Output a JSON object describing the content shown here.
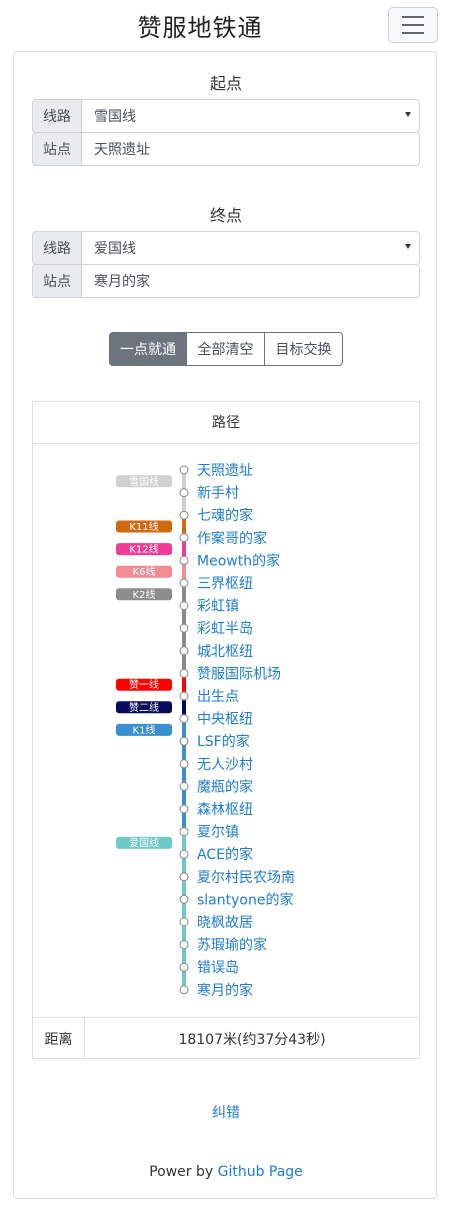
{
  "app": {
    "title": "赞服地铁通"
  },
  "origin": {
    "title": "起点",
    "line_label": "线路",
    "line_value": "雪国线",
    "station_label": "站点",
    "station_value": "天照遗址"
  },
  "destination": {
    "title": "终点",
    "line_label": "线路",
    "line_value": "爱国线",
    "station_label": "站点",
    "station_value": "寒月的家"
  },
  "actions": {
    "go": "一点就通",
    "clear": "全部清空",
    "swap": "目标交换"
  },
  "route": {
    "header": "路径",
    "lines": [
      {
        "name": "雪国线",
        "color": "#cfcfcf",
        "start": 0,
        "end": 1
      },
      {
        "name": "K11线",
        "color": "#d2690f",
        "start": 2,
        "end": 2
      },
      {
        "name": "K12线",
        "color": "#f23a97",
        "start": 3,
        "end": 3
      },
      {
        "name": "K6线",
        "color": "#f28c94",
        "start": 4,
        "end": 4
      },
      {
        "name": "K2线",
        "color": "#8c8c8c",
        "start": 5,
        "end": 8
      },
      {
        "name": "赞一线",
        "color": "#ff0000",
        "start": 9,
        "end": 9
      },
      {
        "name": "赞二线",
        "color": "#0a0a5c",
        "start": 10,
        "end": 10
      },
      {
        "name": "K1线",
        "color": "#3a8fcf",
        "start": 11,
        "end": 15
      },
      {
        "name": "爱国线",
        "color": "#6cc9c4",
        "start": 16,
        "end": 22
      }
    ],
    "stations": [
      "天照遗址",
      "新手村",
      "七魂的家",
      "作案哥的家",
      "Meowth的家",
      "三界枢纽",
      "彩虹镇",
      "彩虹半岛",
      "城北枢纽",
      "赞服国际机场",
      "出生点",
      "中央枢纽",
      "LSF的家",
      "无人沙村",
      "魔瓶的家",
      "森林枢纽",
      "夏尔镇",
      "ACE的家",
      "夏尔村民农场南",
      "slantyone的家",
      "晓枫故居",
      "苏瑕瑜的家",
      "错误岛",
      "寒月的家"
    ],
    "distance_label": "距离",
    "distance_value": "18107米(约37分43秒)"
  },
  "links": {
    "correction": "纠错"
  },
  "footer": {
    "prefix": "Power by ",
    "link": "Github Page"
  }
}
